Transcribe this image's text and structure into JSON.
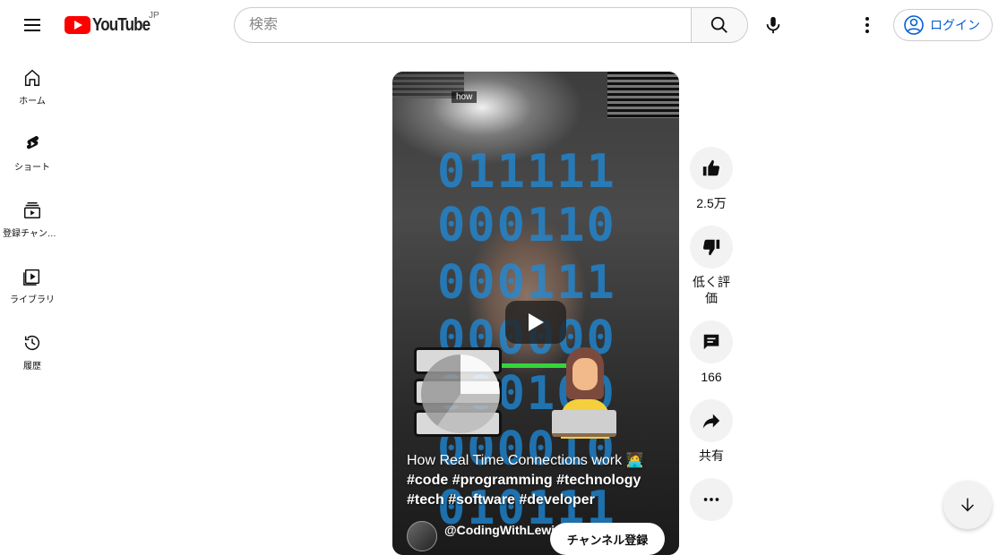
{
  "header": {
    "logo_text": "YouTube",
    "country_code": "JP",
    "search_placeholder": "検索",
    "login_label": "ログイン"
  },
  "sidebar": {
    "items": [
      {
        "label": "ホーム",
        "icon": "home-icon"
      },
      {
        "label": "ショート",
        "icon": "shorts-icon"
      },
      {
        "label": "登録チャンネル",
        "icon": "subscriptions-icon"
      },
      {
        "label": "ライブラリ",
        "icon": "library-icon"
      },
      {
        "label": "履歴",
        "icon": "history-icon"
      }
    ]
  },
  "short": {
    "caption_tag": "how",
    "binary_rows": [
      "011111",
      "000110",
      "000111",
      "000000",
      "000100",
      "000010",
      "010111"
    ],
    "title_line1": "How Real Time Connections work 🧑‍💻",
    "title_line2": "#code #programming #technology",
    "title_line3": "#tech #software #developer",
    "channel_name": "@CodingWithLewi",
    "subscribe_label": "チャンネル登録"
  },
  "actions": {
    "like_count": "2.5万",
    "dislike_label": "低く評価",
    "comment_count": "166",
    "share_label": "共有"
  },
  "colors": {
    "brand_red": "#ff0000",
    "link_blue": "#065fd4",
    "binary_blue": "#1e8cdc",
    "connection_green": "#33d639"
  }
}
